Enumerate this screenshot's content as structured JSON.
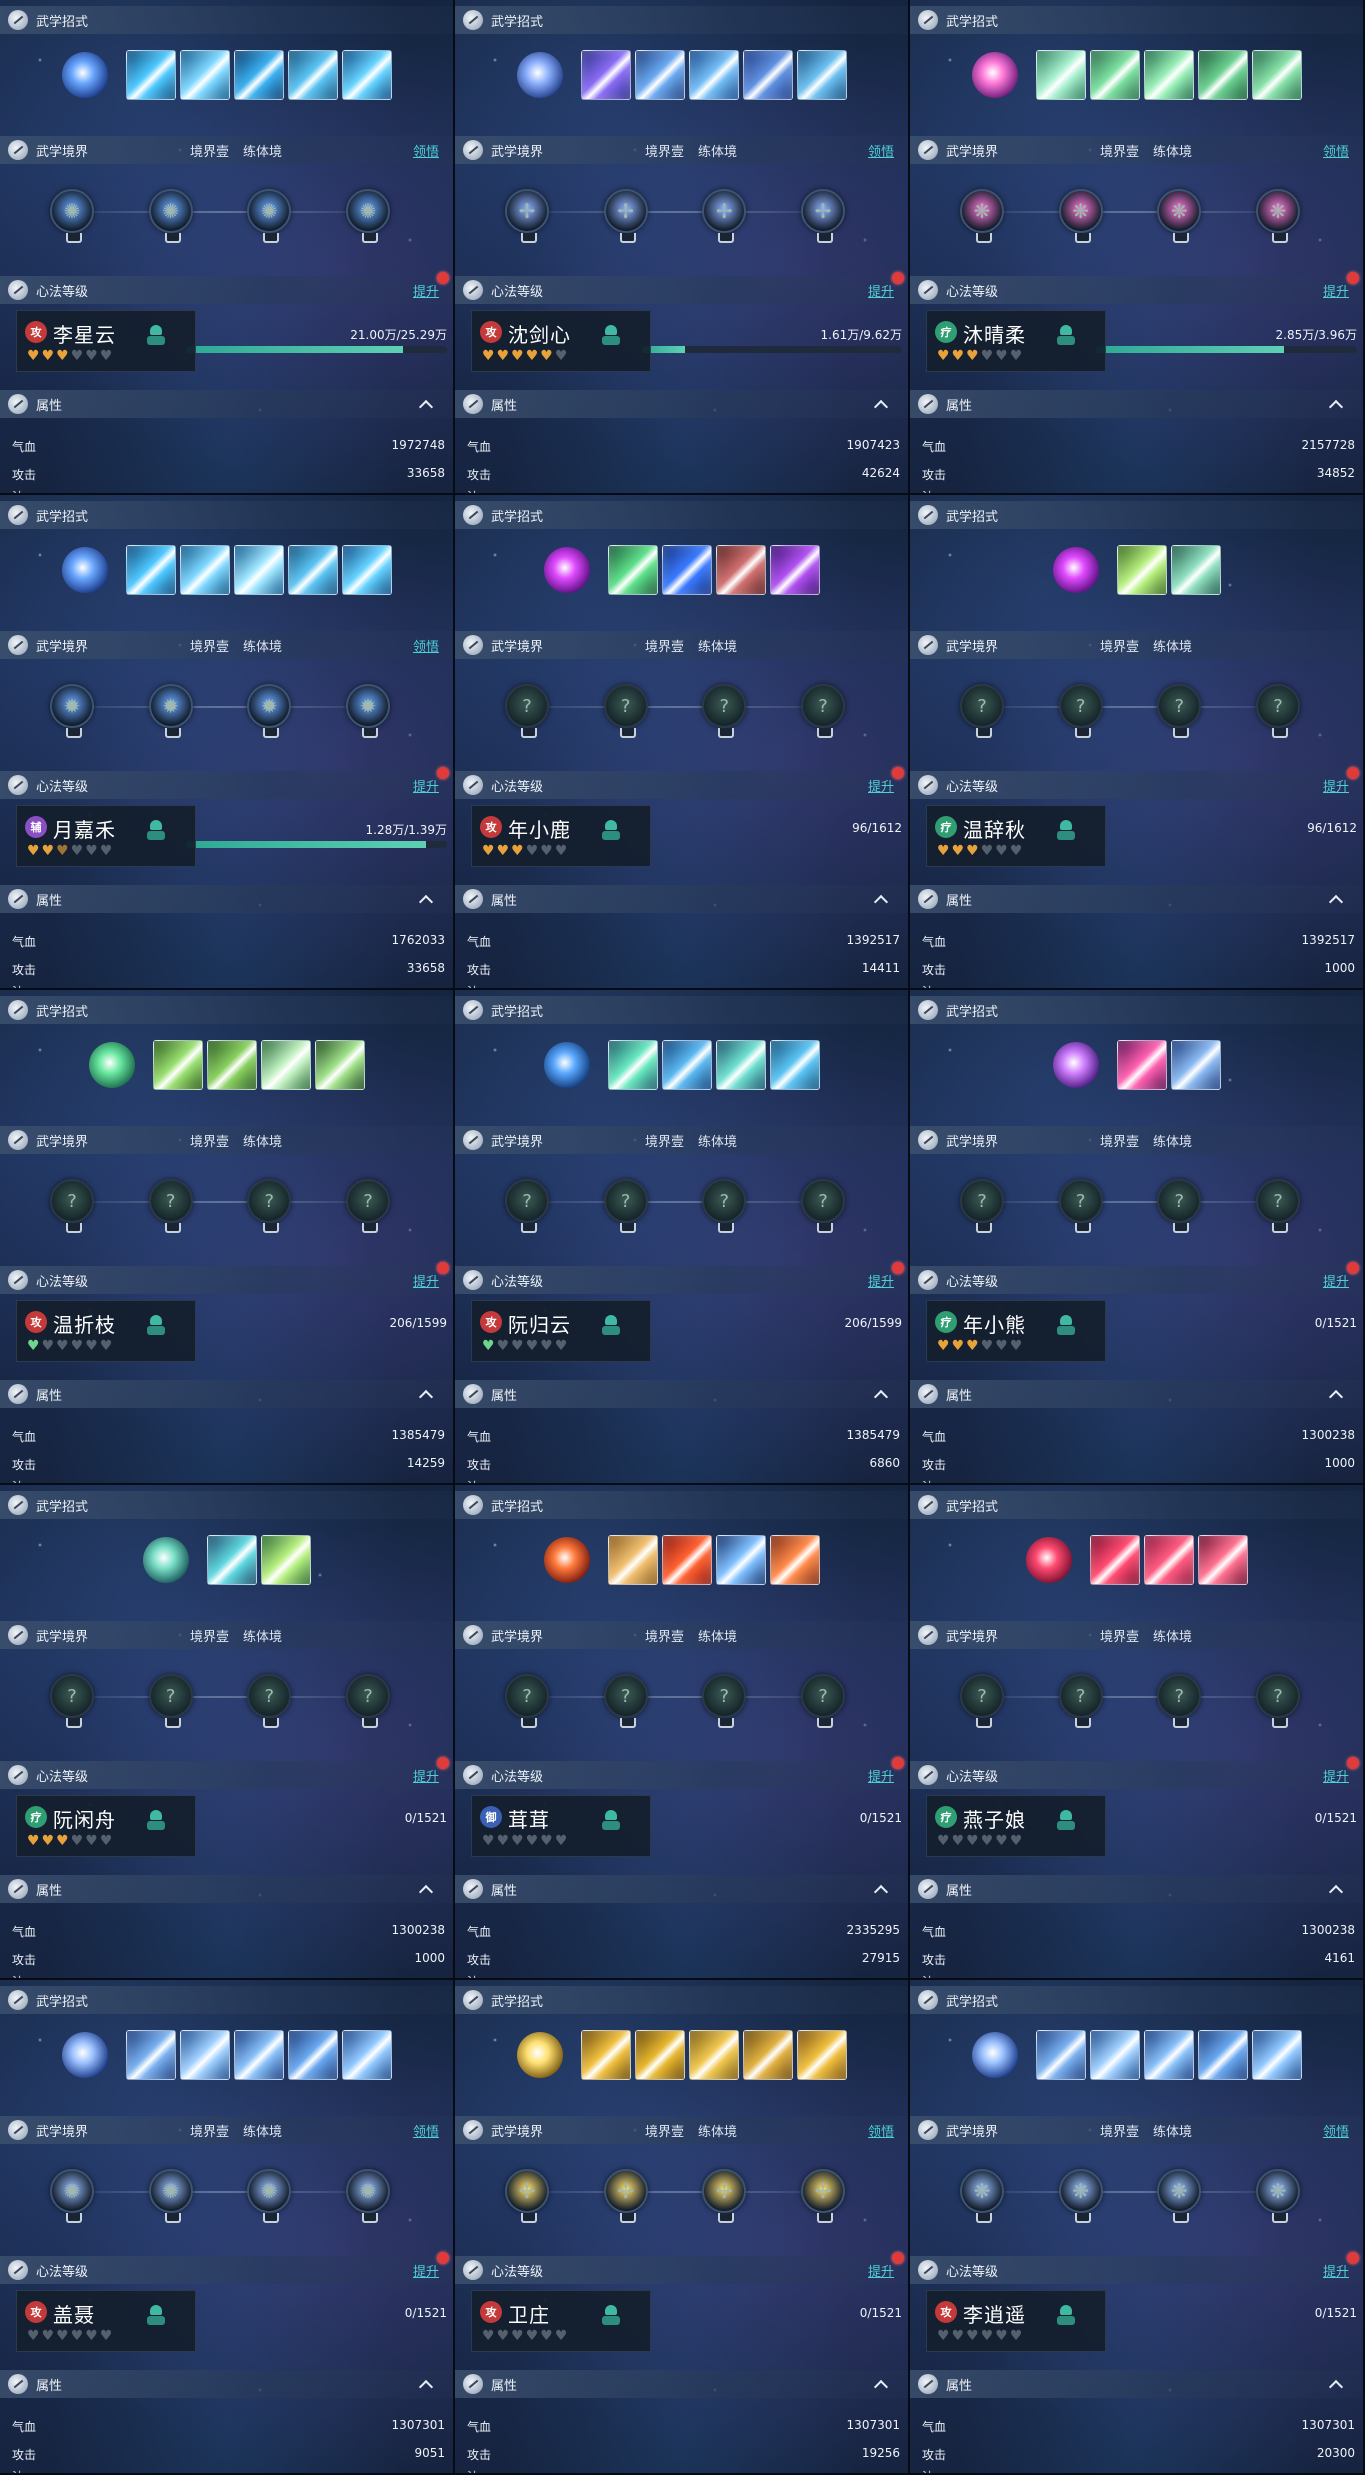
{
  "labels": {
    "moves": "武学招式",
    "realm": "武学境界",
    "realm_tab1": "境界壹",
    "realm_tab2": "练体境",
    "comprehend": "领悟",
    "level": "心法等级",
    "upgrade": "提升",
    "attrs": "属性",
    "hp": "气血",
    "atk": "攻击",
    "next_attr_partial": "法"
  },
  "colors": {
    "attack_faction": "#c43a3a",
    "heal_faction": "#2f9e72",
    "support_faction": "#8b4fc4",
    "defend_faction": "#3a5fb5",
    "link": "#4dd0d6",
    "progress": "#4fc2a7",
    "heart_on": "#e8a23b"
  },
  "panels": [
    {
      "name": "李星云",
      "faction": "攻",
      "faction_color": "#c43a3a",
      "hearts": [
        "on",
        "on",
        "on",
        "off",
        "off",
        "off"
      ],
      "progress_text": "21.00万/25.29万",
      "progress": 0.83,
      "show_bar": true,
      "hp": "1972748",
      "atk": "33658",
      "realm_lit": true,
      "show_comprehend": true,
      "main_skill": [
        "#6aa8ff",
        "#1a3a8a"
      ],
      "skills": [
        [
          "#4ec8ff",
          "#0e4a7a"
        ],
        [
          "#7fd8ff",
          "#105888"
        ],
        [
          "#3ab0ee",
          "#0d3c70"
        ],
        [
          "#5cc4f2",
          "#13527c"
        ],
        [
          "#64d2ff",
          "#0f4a82"
        ]
      ],
      "realm_glyph": "✺"
    },
    {
      "name": "沈剑心",
      "faction": "攻",
      "faction_color": "#c43a3a",
      "hearts": [
        "on",
        "on",
        "on",
        "on",
        "on",
        "off"
      ],
      "progress_text": "1.61万/9.62万",
      "progress": 0.17,
      "show_bar": true,
      "hp": "1907423",
      "atk": "42624",
      "realm_lit": true,
      "show_comprehend": true,
      "main_skill": [
        "#8fb2ff",
        "#23408c"
      ],
      "skills": [
        [
          "#8a6cf5",
          "#2a2f86"
        ],
        [
          "#6aa8f0",
          "#1d3d7a"
        ],
        [
          "#74bdf5",
          "#17488a"
        ],
        [
          "#5e8fe0",
          "#203c84"
        ],
        [
          "#6cc0f0",
          "#154a7c"
        ]
      ],
      "realm_glyph": "✢"
    },
    {
      "name": "沐晴柔",
      "faction": "疗",
      "faction_color": "#2f9e72",
      "hearts": [
        "on",
        "on",
        "on",
        "off",
        "off",
        "off"
      ],
      "progress_text": "2.85万/3.96万",
      "progress": 0.72,
      "show_bar": true,
      "hp": "2157728",
      "atk": "34852",
      "realm_lit": true,
      "show_comprehend": true,
      "main_skill": [
        "#ff7ad8",
        "#6a1a7a"
      ],
      "skills": [
        [
          "#a8f0d0",
          "#2a7a5a"
        ],
        [
          "#7ce0a0",
          "#2a6a4a"
        ],
        [
          "#9af0b8",
          "#1e6a4a"
        ],
        [
          "#6cd090",
          "#1a5a3a"
        ],
        [
          "#88e0a8",
          "#226a48"
        ]
      ],
      "realm_glyph": "❋"
    },
    {
      "name": "月嘉禾",
      "faction": "辅",
      "faction_color": "#8b4fc4",
      "hearts": [
        "on",
        "on",
        "half",
        "off",
        "off",
        "off"
      ],
      "progress_text": "1.28万/1.39万",
      "progress": 0.92,
      "show_bar": true,
      "hp": "1762033",
      "atk": "33658",
      "realm_lit": true,
      "show_comprehend": true,
      "main_skill": [
        "#6aa8ff",
        "#1a3a8a"
      ],
      "skills": [
        [
          "#4ec8ff",
          "#0e4a7a"
        ],
        [
          "#7fd8ff",
          "#105888"
        ],
        [
          "#9fe6ff",
          "#125a90"
        ],
        [
          "#5cc4f2",
          "#13527c"
        ],
        [
          "#64d2ff",
          "#0f4a82"
        ]
      ],
      "realm_glyph": "✹"
    },
    {
      "name": "年小鹿",
      "faction": "攻",
      "faction_color": "#c43a3a",
      "hearts": [
        "on",
        "on",
        "on",
        "off",
        "off",
        "off"
      ],
      "progress_text": "96/1612",
      "progress": 0.06,
      "show_bar": false,
      "hp": "1392517",
      "atk": "14411",
      "realm_lit": false,
      "show_comprehend": false,
      "main_skill": [
        "#e04aff",
        "#5a1080"
      ],
      "skills": [
        [
          "#5ee08a",
          "#1a5a3a"
        ],
        [
          "#3a7aff",
          "#12307a"
        ],
        [
          "#d07070",
          "#5a2020"
        ],
        [
          "#b050f0",
          "#3a1070"
        ]
      ],
      "realm_glyph": "?"
    },
    {
      "name": "温辞秋",
      "faction": "疗",
      "faction_color": "#2f9e72",
      "hearts": [
        "on",
        "on",
        "on",
        "off",
        "off",
        "off"
      ],
      "progress_text": "96/1612",
      "progress": 0.06,
      "show_bar": false,
      "hp": "1392517",
      "atk": "1000",
      "realm_lit": false,
      "show_comprehend": false,
      "main_skill": [
        "#e04aff",
        "#5a1080"
      ],
      "skills": [
        [
          "#b8f080",
          "#3a6a20"
        ],
        [
          "#90e0c0",
          "#1e5a4a"
        ]
      ],
      "realm_glyph": "?"
    },
    {
      "name": "温折枝",
      "faction": "攻",
      "faction_color": "#c43a3a",
      "hearts": [
        "green",
        "off",
        "off",
        "off",
        "off",
        "off"
      ],
      "progress_text": "206/1599",
      "progress": 0.13,
      "show_bar": false,
      "hp": "1385479",
      "atk": "14259",
      "realm_lit": false,
      "show_comprehend": false,
      "main_skill": [
        "#6ae8a0",
        "#1a6a4a"
      ],
      "skills": [
        [
          "#9ae070",
          "#2a5a1a"
        ],
        [
          "#8ad060",
          "#2a5a20"
        ],
        [
          "#c0f0c0",
          "#2a6a3a"
        ],
        [
          "#a0e088",
          "#1e4a20"
        ]
      ],
      "realm_glyph": "?"
    },
    {
      "name": "阮归云",
      "faction": "攻",
      "faction_color": "#c43a3a",
      "hearts": [
        "green",
        "off",
        "off",
        "off",
        "off",
        "off"
      ],
      "progress_text": "206/1599",
      "progress": 0.13,
      "show_bar": false,
      "hp": "1385479",
      "atk": "6860",
      "realm_lit": false,
      "show_comprehend": false,
      "main_skill": [
        "#5aa8ff",
        "#123a7a"
      ],
      "skills": [
        [
          "#6ae8c0",
          "#1a5a6a"
        ],
        [
          "#5ab8f0",
          "#12407a"
        ],
        [
          "#70e0d0",
          "#17506a"
        ],
        [
          "#5cc4f2",
          "#13527c"
        ]
      ],
      "realm_glyph": "?"
    },
    {
      "name": "年小熊",
      "faction": "疗",
      "faction_color": "#2f9e72",
      "hearts": [
        "on",
        "on",
        "on",
        "off",
        "off",
        "off"
      ],
      "progress_text": "0/1521",
      "progress": 0,
      "show_bar": false,
      "hp": "1300238",
      "atk": "1000",
      "realm_lit": false,
      "show_comprehend": false,
      "main_skill": [
        "#d080ff",
        "#4a1a80"
      ],
      "skills": [
        [
          "#ff60b0",
          "#5a1050"
        ],
        [
          "#8ab8f0",
          "#1a3a7a"
        ]
      ],
      "realm_glyph": "?"
    },
    {
      "name": "阮闲舟",
      "faction": "疗",
      "faction_color": "#2f9e72",
      "hearts": [
        "on",
        "on",
        "on",
        "off",
        "off",
        "off"
      ],
      "progress_text": "0/1521",
      "progress": 0,
      "show_bar": false,
      "hp": "1300238",
      "atk": "1000",
      "realm_lit": false,
      "show_comprehend": false,
      "main_skill": [
        "#7ae0c8",
        "#1a5a5a"
      ],
      "skills": [
        [
          "#60d8e0",
          "#1a4a6a"
        ],
        [
          "#b8f080",
          "#2a6a30"
        ]
      ],
      "realm_glyph": "?"
    },
    {
      "name": "茸茸",
      "faction": "御",
      "faction_color": "#3a5fb5",
      "hearts": [
        "off",
        "off",
        "off",
        "off",
        "off",
        "off"
      ],
      "progress_text": "0/1521",
      "progress": 0,
      "show_bar": false,
      "hp": "2335295",
      "atk": "27915",
      "realm_lit": false,
      "show_comprehend": false,
      "main_skill": [
        "#ff7a3a",
        "#7a1a10"
      ],
      "skills": [
        [
          "#f0c070",
          "#8a5a1a"
        ],
        [
          "#ff6030",
          "#8a1a10"
        ],
        [
          "#80c0ff",
          "#12306a"
        ],
        [
          "#ff8a4a",
          "#7a2a10"
        ]
      ],
      "realm_glyph": "?"
    },
    {
      "name": "燕子娘",
      "faction": "疗",
      "faction_color": "#2f9e72",
      "hearts": [
        "off",
        "off",
        "off",
        "off",
        "off",
        "off"
      ],
      "progress_text": "0/1521",
      "progress": 0,
      "show_bar": false,
      "hp": "1300238",
      "atk": "4161",
      "realm_lit": false,
      "show_comprehend": false,
      "main_skill": [
        "#ff4a70",
        "#7a1030"
      ],
      "skills": [
        [
          "#ff4a70",
          "#7a1030"
        ],
        [
          "#ff5a80",
          "#8a1a40"
        ],
        [
          "#ff7090",
          "#6a1030"
        ]
      ],
      "realm_glyph": "?"
    },
    {
      "name": "盖聂",
      "faction": "攻",
      "faction_color": "#c43a3a",
      "hearts": [
        "off",
        "off",
        "off",
        "off",
        "off",
        "off"
      ],
      "progress_text": "0/1521",
      "progress": 0,
      "show_bar": false,
      "hp": "1307301",
      "atk": "9051",
      "realm_lit": true,
      "show_comprehend": true,
      "main_skill": [
        "#9ac0ff",
        "#1a3a8a"
      ],
      "skills": [
        [
          "#7ab0f0",
          "#1a3a7a"
        ],
        [
          "#a0d0ff",
          "#1a4a8a"
        ],
        [
          "#88c0f8",
          "#173c80"
        ],
        [
          "#6aa8f0",
          "#1a3a78"
        ],
        [
          "#90c8ff",
          "#1a4484"
        ]
      ],
      "realm_glyph": "✺"
    },
    {
      "name": "卫庄",
      "faction": "攻",
      "faction_color": "#c43a3a",
      "hearts": [
        "off",
        "off",
        "off",
        "off",
        "off",
        "off"
      ],
      "progress_text": "0/1521",
      "progress": 0,
      "show_bar": false,
      "hp": "1307301",
      "atk": "19256",
      "realm_lit": true,
      "show_comprehend": true,
      "main_skill": [
        "#ffe070",
        "#7a5a10"
      ],
      "skills": [
        [
          "#f0c040",
          "#6a4a0a"
        ],
        [
          "#e8b830",
          "#6a4a0a"
        ],
        [
          "#f0c850",
          "#7a5a10"
        ],
        [
          "#e0b040",
          "#6a4a10"
        ],
        [
          "#f0c040",
          "#7a5010"
        ]
      ],
      "realm_glyph": "✢"
    },
    {
      "name": "李逍遥",
      "faction": "攻",
      "faction_color": "#c43a3a",
      "hearts": [
        "off",
        "off",
        "off",
        "off",
        "off",
        "off"
      ],
      "progress_text": "0/1521",
      "progress": 0,
      "show_bar": false,
      "hp": "1307301",
      "atk": "20300",
      "realm_lit": true,
      "show_comprehend": true,
      "main_skill": [
        "#9ac0ff",
        "#1a3a8a"
      ],
      "skills": [
        [
          "#7ab0f0",
          "#1a3a7a"
        ],
        [
          "#a0d0ff",
          "#1a4a8a"
        ],
        [
          "#88c0f8",
          "#173c80"
        ],
        [
          "#6aa8f0",
          "#1a3a78"
        ],
        [
          "#90c8ff",
          "#1a4484"
        ]
      ],
      "realm_glyph": "❋"
    }
  ]
}
